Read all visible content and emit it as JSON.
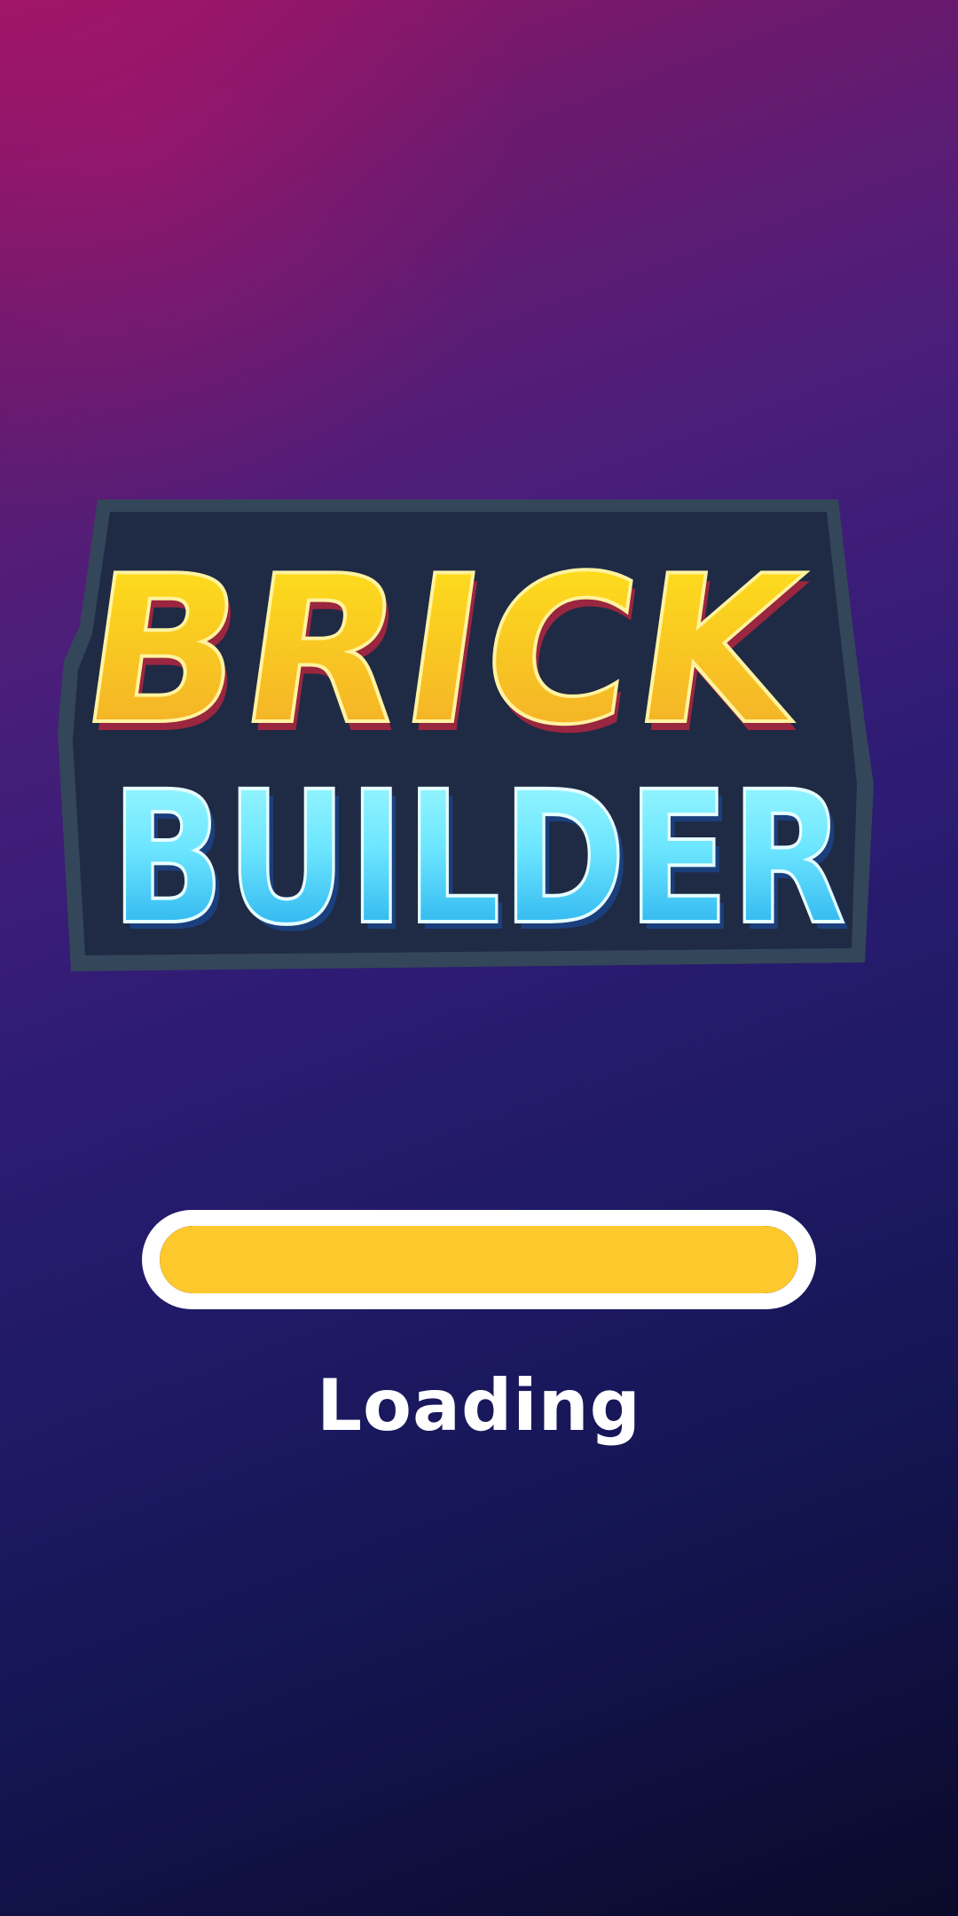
{
  "logo": {
    "line1": "BRICK",
    "line2": "BUILDER",
    "colors": {
      "plate": "#34465a",
      "line1_top": "#ffe51a",
      "line1_bottom": "#f2a92a",
      "line1_side": "#9a2640",
      "line2_top": "#a6fbff",
      "line2_bottom": "#16a3ea",
      "line2_side": "#1b3f7c"
    }
  },
  "loader": {
    "progress": 1.0,
    "fill_color": "#fdc82b",
    "label": "Loading"
  },
  "background": {
    "top_left": "#9a1566",
    "bottom_right": "#0a0a2a"
  }
}
